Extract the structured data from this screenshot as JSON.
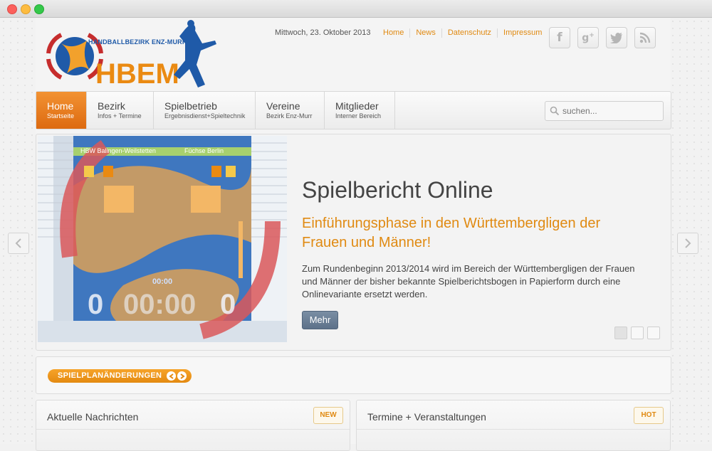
{
  "window": {
    "buttons": [
      "close",
      "minimize",
      "maximize"
    ]
  },
  "header": {
    "logo_text": "HANDBALLBEZIRK ENZ-MURR",
    "logo_word": "HBEM",
    "date": "Mittwoch, 23. Oktober 2013",
    "links": [
      "Home",
      "News",
      "Datenschutz",
      "Impressum"
    ],
    "social": [
      {
        "name": "facebook-icon",
        "glyph": "f"
      },
      {
        "name": "google-plus-icon",
        "glyph": "g+"
      },
      {
        "name": "twitter-icon",
        "glyph": "t"
      },
      {
        "name": "rss-icon",
        "glyph": "rss"
      }
    ]
  },
  "nav": {
    "items": [
      {
        "label": "Home",
        "sub": "Startseite",
        "active": true
      },
      {
        "label": "Bezirk",
        "sub": "Infos + Termine"
      },
      {
        "label": "Spielbetrieb",
        "sub": "Ergebnisdienst+Spieltechnik"
      },
      {
        "label": "Vereine",
        "sub": "Bezirk Enz-Murr"
      },
      {
        "label": "Mitglieder",
        "sub": "Interner Bereich"
      }
    ],
    "search_placeholder": "suchen..."
  },
  "slider": {
    "title": "Spielbericht Online",
    "subtitle": "Einführungsphase in den Württembergligen der Frauen und Männer!",
    "text": "Zum Rundenbeginn 2013/2014 wird im Bereich der Württembergligen der Frauen und Männer der bisher bekannte Spielberichtsbogen in Papierform durch eine Onlinevariante ersetzt werden.",
    "button": "Mehr",
    "image": {
      "team_home": "HBW Balingen-Weilstetten",
      "team_away": "Füchse Berlin",
      "clock": "00:00",
      "score_home": "0",
      "score_away": "0",
      "small_clock": "00:00"
    },
    "slide_count": 3,
    "active_slide": 1
  },
  "ticker": {
    "label": "SPIELPLANÄNDERUNGEN"
  },
  "panels": [
    {
      "title": "Aktuelle Nachrichten",
      "badge": "NEW"
    },
    {
      "title": "Termine + Veranstaltungen",
      "badge": "HOT"
    }
  ],
  "colors": {
    "accent": "#e08a12",
    "nav_active": "#e8781a",
    "button": "#667a92",
    "logo_blue": "#1f5aa8",
    "logo_red": "#c62d2d"
  }
}
